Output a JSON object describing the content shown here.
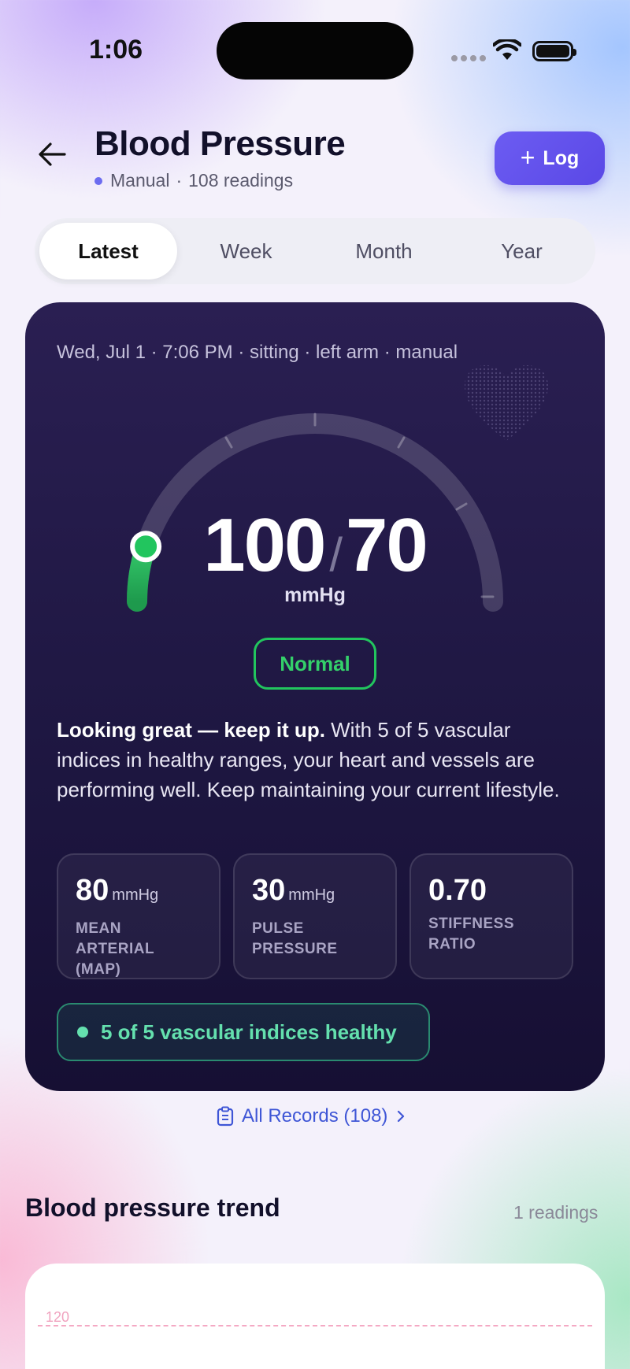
{
  "status_bar": {
    "time": "1:06"
  },
  "header": {
    "title": "Blood Pressure",
    "source": "Manual",
    "separator": "·",
    "readings_count": "108 readings",
    "log_button": "Log"
  },
  "tabs": [
    {
      "label": "Latest",
      "active": true
    },
    {
      "label": "Week",
      "active": false
    },
    {
      "label": "Month",
      "active": false
    },
    {
      "label": "Year",
      "active": false
    }
  ],
  "reading": {
    "meta": "Wed, Jul 1  ·  7:06 PM  ·  sitting  ·  left arm  ·  manual",
    "systolic": "100",
    "slash": "/",
    "diastolic": "70",
    "unit": "mmHg",
    "status": "Normal",
    "gauge_level": 0.1,
    "message_bold": "Looking great — keep it up.",
    "message_rest": " With 5 of 5 vascular indices in healthy ranges, your heart and vessels are performing well. Keep maintaining your current lifestyle."
  },
  "stats": [
    {
      "value": "80",
      "unit": "mmHg",
      "label_line1": "MEAN ARTERIAL",
      "label_line2": "(MAP)"
    },
    {
      "value": "30",
      "unit": "mmHg",
      "label_line1": "PULSE",
      "label_line2": "PRESSURE"
    },
    {
      "value": "0.70",
      "unit": "",
      "label_line1": "STIFFNESS",
      "label_line2": "RATIO"
    }
  ],
  "vascular_summary": "5 of 5 vascular indices healthy",
  "records_link": "All Records (108)",
  "trend": {
    "title": "Blood pressure trend",
    "count": "1 readings",
    "axis_tick": "120"
  },
  "colors": {
    "accent": "#5a48e6",
    "normal_green": "#22c55e",
    "card_bg": "#1d1640",
    "healthy_mint": "#64e0ae"
  }
}
